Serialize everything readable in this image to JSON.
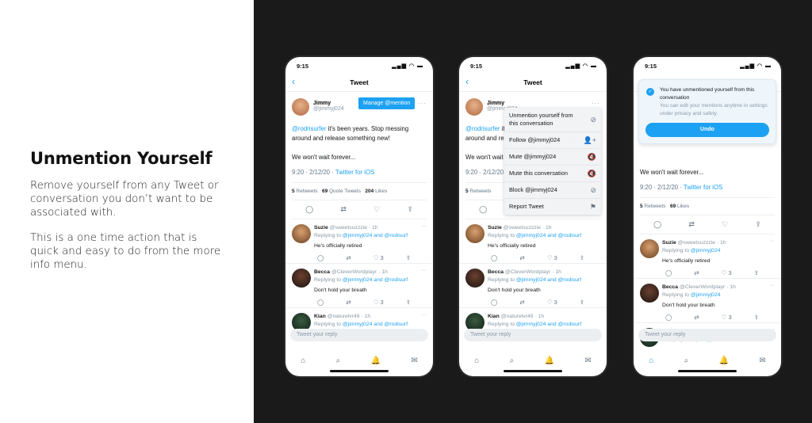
{
  "intro": {
    "title": "Unmention Yourself",
    "para1": "Remove yourself from any Tweet or conversation you don’t want to be associated with.",
    "para2": "This is a one time action that is quick and easy to do from the more info menu."
  },
  "colors": {
    "accent": "#1da1f2",
    "background_dark": "#1a1a1a"
  },
  "common": {
    "time": "9:15",
    "status_icons": "▂▄▆ ◠ ▬",
    "back": "‹",
    "nav_title": "Tweet",
    "author_name": "Jimmy",
    "author_handle": "@jimmyj024",
    "tweet_mention": "@rodrisurfer",
    "tweet_text": " it's been years. Stop messing around and release something new!",
    "tweet_text2": "We won't wait forever...",
    "tweet_time": "9:20 · 2/12/20 · ",
    "tweet_client": "Twitter for iOS",
    "reply_placeholder": "Tweet your reply",
    "more": "···",
    "icons": {
      "reply": "◯",
      "retweet": "⇄",
      "like": "♡",
      "share": "⇪",
      "home": "⌂",
      "search": "⌕",
      "bell": "🔔",
      "mail": "✉"
    }
  },
  "phone1": {
    "chip": "Manage @mention",
    "stats": {
      "retweets_n": "5",
      "retweets": " Retweets",
      "quotes_n": "69",
      "quotes": " Quote Tweets",
      "likes_n": "204",
      "likes": " Likes"
    },
    "replies": [
      {
        "name": "Suzie",
        "handle": " @sweetsuzzzie · 1h",
        "replying": "Replying to ",
        "to": "@jimmyj024 and @rodisurf",
        "text": "He's officially retired",
        "likes": "3"
      },
      {
        "name": "Becca",
        "handle": " @CleverWordplayr · 1h",
        "replying": "Replying to ",
        "to": "@jimmyj024 and @rodisurf",
        "text": "Don't hold your breath",
        "likes": "3"
      },
      {
        "name": "Kian",
        "handle": " @naturelvr49 · 1h",
        "replying": "Replying to ",
        "to": "@jimmyj024 and @rodisurf",
        "text": "",
        "likes": ""
      }
    ]
  },
  "phone2": {
    "stats_retweets_n": "5",
    "stats_retweets": " Retweets",
    "menu": [
      {
        "label": "Unmention yourself from this conversation",
        "icon": "⊘"
      },
      {
        "label": "Follow @jimmyj024",
        "icon": "👤+"
      },
      {
        "label": "Mute @jimmyj024",
        "icon": "🔇"
      },
      {
        "label": "Mute this conversation",
        "icon": "🔇"
      },
      {
        "label": "Block @jimmyj024",
        "icon": "⊘"
      },
      {
        "label": "Report Tweet",
        "icon": "⚑"
      }
    ]
  },
  "phone3": {
    "toast_title": "You have unmentioned yourself from this conversation",
    "toast_sub": "You can edit your mentions anytime in settings under privacy and safety.",
    "undo": "Undo",
    "stats": {
      "retweets_n": "5",
      "retweets": " Retweets",
      "likes_n": "69",
      "likes": " Likes"
    },
    "replies": [
      {
        "name": "Suzie",
        "handle": " @sweetsuzzzie · 1h",
        "replying": "Replying to ",
        "to": "@jimmyj024",
        "text": "He's officially retired",
        "likes": "3"
      },
      {
        "name": "Becca",
        "handle": " @CleverWordplayr · 1h",
        "replying": "Replying to ",
        "to": "@jimmyj024",
        "text": "Don't hold your breath",
        "likes": "3"
      },
      {
        "name": "Kian",
        "handle": " @naturelvr49 · 1h",
        "replying": "Replying to ",
        "to": "@jimmyj024",
        "text": "",
        "likes": ""
      }
    ]
  }
}
